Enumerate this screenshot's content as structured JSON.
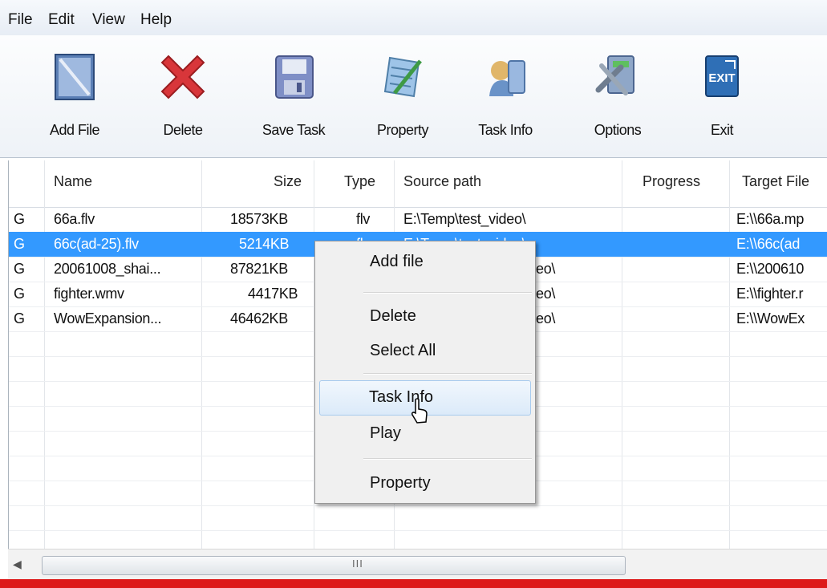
{
  "menu": [
    "File",
    "Edit",
    "View",
    "Help"
  ],
  "toolbar": [
    {
      "label": "Add File",
      "icon": "add-file-icon"
    },
    {
      "label": "Delete",
      "icon": "delete-icon"
    },
    {
      "label": "Save Task",
      "icon": "save-task-icon"
    },
    {
      "label": "Property",
      "icon": "property-icon"
    },
    {
      "label": "Task Info",
      "icon": "task-info-icon"
    },
    {
      "label": "Options",
      "icon": "options-icon"
    },
    {
      "label": "Exit",
      "icon": "exit-icon"
    }
  ],
  "table": {
    "columns": [
      "Name",
      "Size",
      "Type",
      "Source path",
      "Progress",
      "Target File"
    ],
    "rows": [
      {
        "status": "G",
        "name": "66a.flv",
        "size": "18573KB",
        "type": "flv",
        "source": "E:\\Temp\\test_video\\",
        "progress": "",
        "target": "E:\\\\66a.mp"
      },
      {
        "status": "G",
        "name": "66c(ad-25).flv",
        "size": "5214KB",
        "type": "flv",
        "source": "E:\\Temp\\test_video\\",
        "progress": "",
        "target": "E:\\\\66c(ad",
        "selected": true
      },
      {
        "status": "G",
        "name": "20061008_shai...",
        "size": "87821KB",
        "type": "",
        "source": "eo\\",
        "progress": "",
        "target": "E:\\\\200610"
      },
      {
        "status": "G",
        "name": "fighter.wmv",
        "size": "4417KB",
        "type": "",
        "source": "eo\\",
        "progress": "",
        "target": "E:\\\\fighter.r"
      },
      {
        "status": "G",
        "name": "WowExpansion...",
        "size": "46462KB",
        "type": "",
        "source": "eo\\",
        "progress": "",
        "target": "E:\\\\WowEx"
      }
    ]
  },
  "context_menu": {
    "items": [
      "Add file",
      "Delete",
      "Select All",
      "Task Info",
      "Play",
      "Property"
    ],
    "highlighted": "Task Info"
  },
  "scrollbar": {
    "grip": "III"
  },
  "colors": {
    "selection": "#3399ff",
    "bottom_bar": "#dd1a1a"
  }
}
